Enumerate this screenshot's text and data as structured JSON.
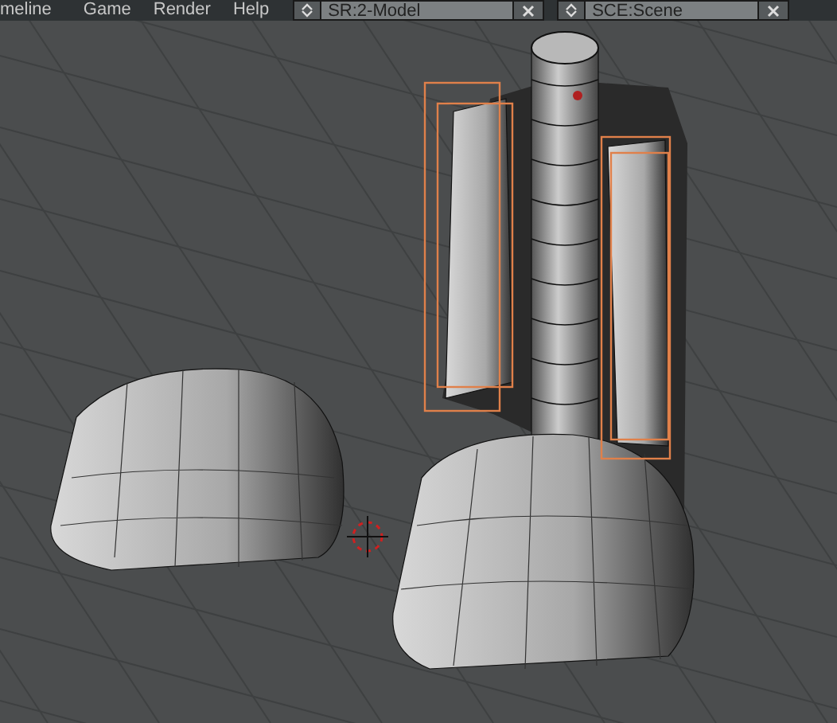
{
  "header": {
    "menus": [
      "meline",
      "Game",
      "Render",
      "Help"
    ],
    "selectors": [
      {
        "kind": "screen",
        "value": "SR:2-Model"
      },
      {
        "kind": "scene",
        "value": "SCE:Scene"
      }
    ]
  }
}
